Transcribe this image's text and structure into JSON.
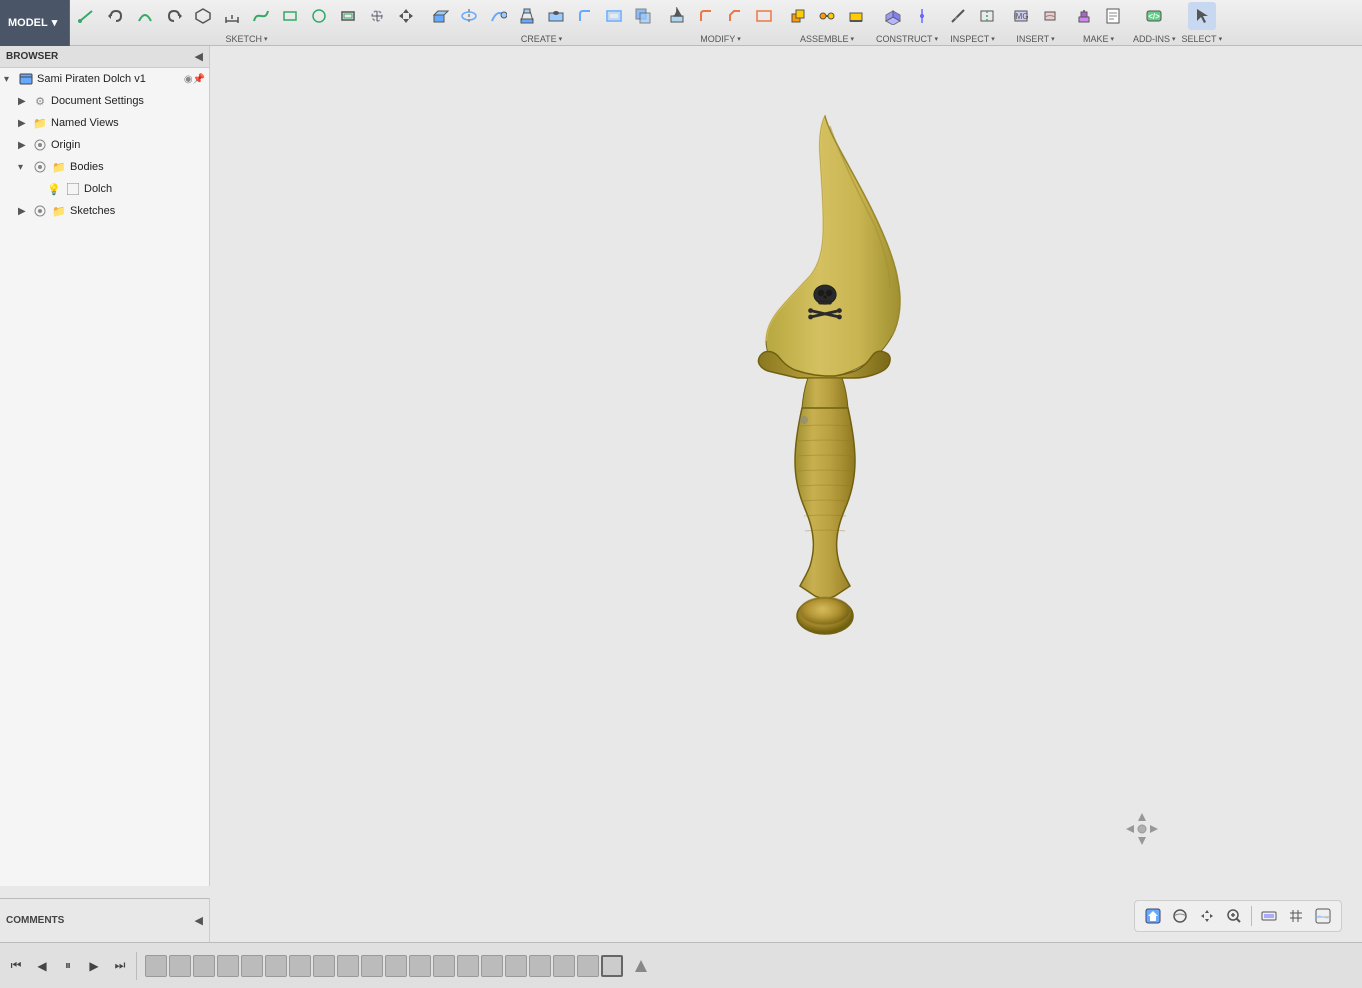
{
  "app": {
    "mode": "MODEL",
    "mode_arrow": "▾"
  },
  "toolbar": {
    "sections": [
      {
        "label": "SKETCH",
        "icons": [
          "✏",
          "↩",
          "〜",
          "↪",
          "△",
          "⬡",
          "—",
          "∿",
          "⬜",
          "◯",
          "✦",
          "⊕"
        ]
      },
      {
        "label": "CREATE",
        "icons": [
          "⬜",
          "◯",
          "⬟",
          "⬡",
          "⊕",
          "△",
          "⊙",
          "✦",
          "⬡"
        ]
      },
      {
        "label": "MODIFY",
        "icons": [
          "⊙",
          "∿",
          "⊕",
          "✦"
        ]
      },
      {
        "label": "ASSEMBLE",
        "icons": [
          "⬡",
          "⊕",
          "⬟"
        ]
      },
      {
        "label": "CONSTRUCT",
        "icons": [
          "⊙",
          "∿"
        ]
      },
      {
        "label": "INSPECT",
        "icons": [
          "🔍",
          "📏"
        ]
      },
      {
        "label": "INSERT",
        "icons": [
          "📥"
        ]
      },
      {
        "label": "MAKE",
        "icons": [
          "🔧"
        ]
      },
      {
        "label": "ADD-INS",
        "icons": [
          "🔌"
        ]
      },
      {
        "label": "SELECT",
        "icons": [
          "↖"
        ]
      }
    ]
  },
  "browser": {
    "title": "BROWSER",
    "tree": [
      {
        "level": 0,
        "expand": "▾",
        "icon": "doc",
        "label": "Sami Piraten Dolch v1",
        "hasEye": true,
        "hasPin": true
      },
      {
        "level": 1,
        "expand": "▶",
        "icon": "gear",
        "label": "Document Settings"
      },
      {
        "level": 1,
        "expand": "▶",
        "icon": "folder",
        "label": "Named Views"
      },
      {
        "level": 1,
        "expand": "▶",
        "icon": "eye",
        "label": "Origin"
      },
      {
        "level": 1,
        "expand": "▾",
        "icon": "folder",
        "label": "Bodies"
      },
      {
        "level": 2,
        "expand": "",
        "icon": "bulb",
        "label": "Dolch"
      },
      {
        "level": 1,
        "expand": "▶",
        "icon": "eye",
        "label": "Sketches"
      }
    ]
  },
  "comments": {
    "label": "COMMENTS"
  },
  "viewport_controls": {
    "buttons": [
      "🏠",
      "👁",
      "✋",
      "🔍",
      "—",
      "⬜",
      "⬜",
      "⬜"
    ]
  },
  "bottom_timeline": {
    "buttons": [
      "⏮",
      "◀",
      "⏸",
      "▶",
      "⏭",
      "—"
    ]
  },
  "dagger": {
    "description": "3D pirate dagger model in gold/brass color with curved blade and skull decoration"
  }
}
